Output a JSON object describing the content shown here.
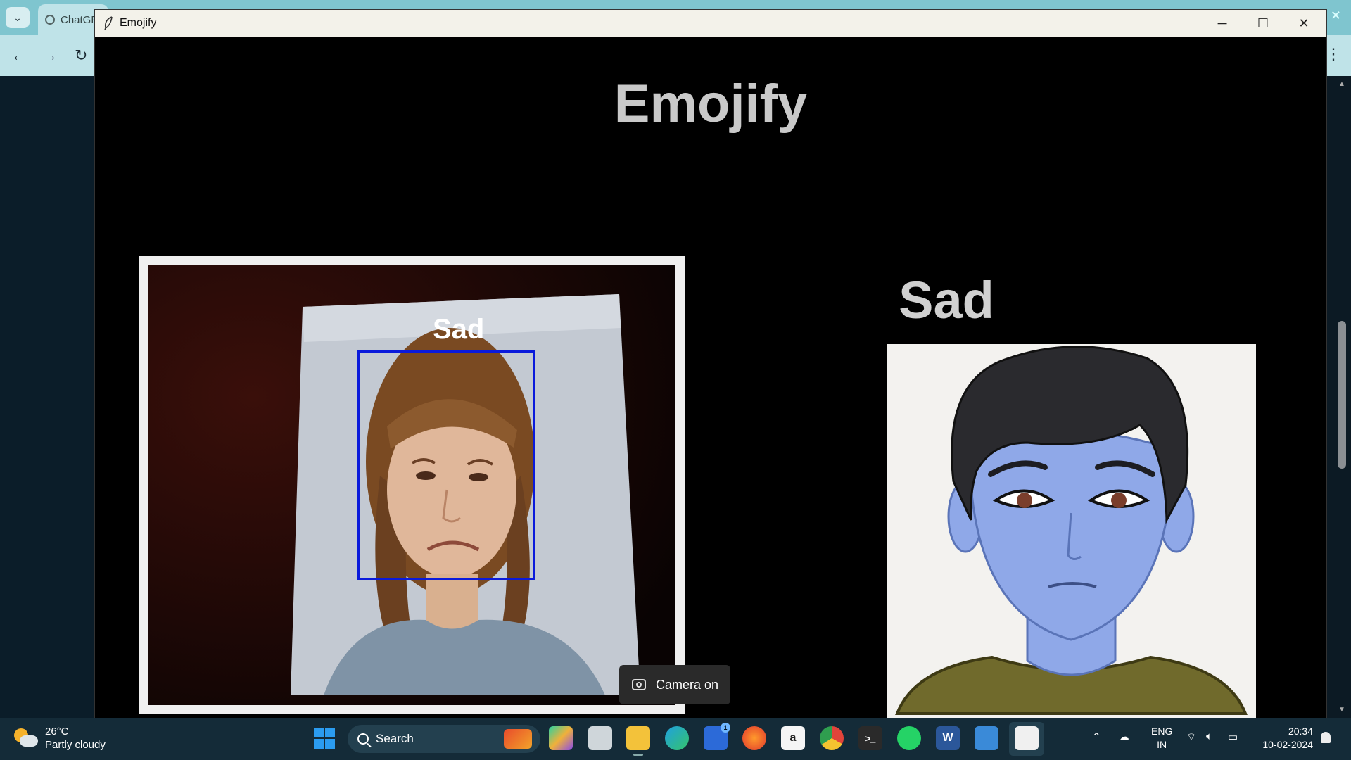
{
  "browser": {
    "tab_title": "ChatGPT"
  },
  "window": {
    "title": "Emojify",
    "controls": {
      "minimize": "─",
      "maximize": "☐",
      "close": "✕"
    }
  },
  "app": {
    "heading": "Emojify",
    "camera_face_label": "Sad",
    "emotion_label": "Sad",
    "toast": "Camera on"
  },
  "taskbar": {
    "weather_temp": "26°C",
    "weather_desc": "Partly cloudy",
    "search_placeholder": "Search",
    "store_badge": "1",
    "lang_line1": "ENG",
    "lang_line2": "IN",
    "time": "20:34",
    "date": "10-02-2024"
  },
  "colors": {
    "face_box": "#0a1adb",
    "emoji_skin": "#8fa8e8",
    "taskbar_bg": "#142b38"
  }
}
